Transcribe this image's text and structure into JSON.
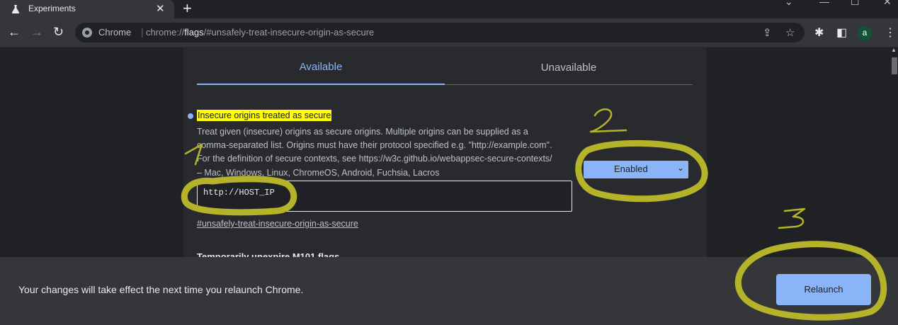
{
  "browser": {
    "tab_title": "Experiments",
    "omnibox_label": "Chrome",
    "url_prefix": "chrome://",
    "url_host": "flags",
    "url_path": "/#unsafely-treat-insecure-origin-as-secure",
    "avatar_letter": "a"
  },
  "flags_page": {
    "tabs": [
      {
        "label": "Available"
      },
      {
        "label": "Unavailable"
      }
    ],
    "flag": {
      "title": "Insecure origins treated as secure",
      "description_lines": [
        "Treat given (insecure) origins as secure origins. Multiple origins can be supplied as a",
        "comma-separated list. Origins must have their protocol specified e.g. \"http://example.com\".",
        "For the definition of secure contexts, see https://w3c.github.io/webappsec-secure-contexts/",
        "– Mac, Windows, Linux, ChromeOS, Android, Fuchsia, Lacros"
      ],
      "input_value": "http://HOST_IP",
      "anchor": "#unsafely-treat-insecure-origin-as-secure",
      "select_value": "Enabled"
    },
    "next_flag_partial": "Temporarily unexpire M101 flags"
  },
  "relaunch": {
    "message": "Your changes will take effect the next time you relaunch Chrome.",
    "button_label": "Relaunch"
  },
  "annotations": {
    "color": "#b5b32a",
    "labels": [
      "1",
      "2",
      "3"
    ]
  }
}
